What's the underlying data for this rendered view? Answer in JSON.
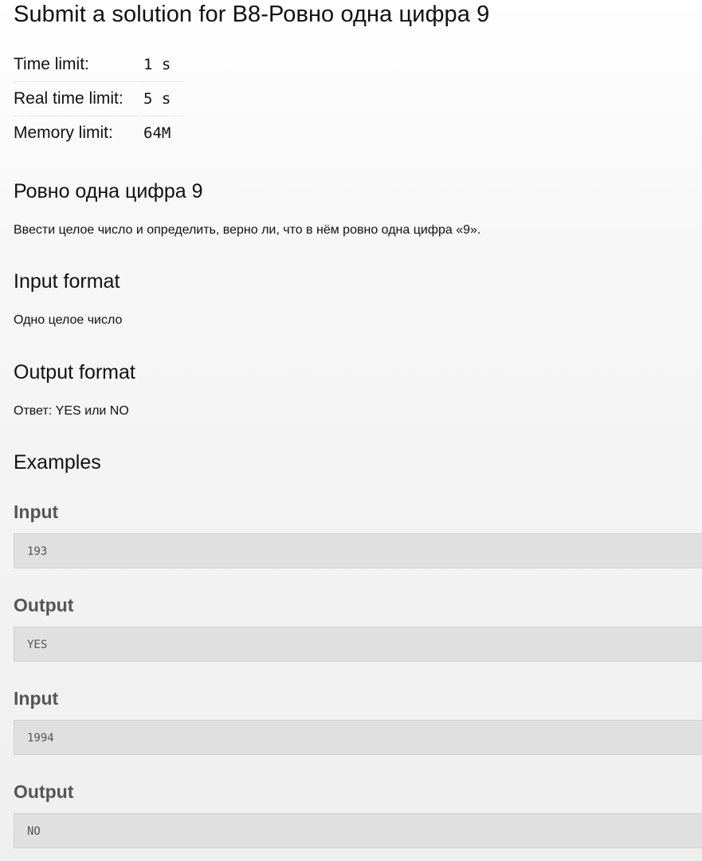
{
  "page": {
    "title": "Submit a solution for B8-Ровно одна цифра 9"
  },
  "limits": [
    {
      "label": "Time limit:",
      "value": "1 s"
    },
    {
      "label": "Real time limit:",
      "value": "5 s"
    },
    {
      "label": "Memory limit:",
      "value": "64M"
    }
  ],
  "statement": {
    "title": "Ровно одна цифра 9",
    "text": "Ввести целое число и определить, верно ли, что в нём ровно одна цифра «9»."
  },
  "input_format": {
    "title": "Input format",
    "text": "Одно целое число"
  },
  "output_format": {
    "title": "Output format",
    "text": "Ответ: YES или NO"
  },
  "examples": {
    "title": "Examples",
    "items": [
      {
        "label": "Input",
        "value": "193"
      },
      {
        "label": "Output",
        "value": "YES"
      },
      {
        "label": "Input",
        "value": "1994"
      },
      {
        "label": "Output",
        "value": "NO"
      }
    ]
  }
}
